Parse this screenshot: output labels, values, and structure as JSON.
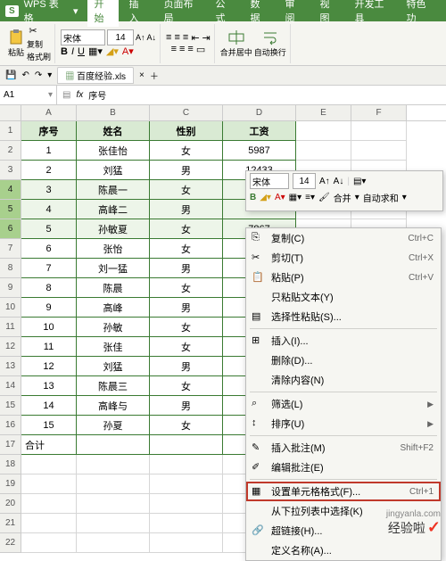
{
  "app": {
    "logo": "S",
    "name": "WPS 表格"
  },
  "tabs": [
    "开始",
    "插入",
    "页面布局",
    "公式",
    "数据",
    "审阅",
    "视图",
    "开发工具",
    "特色功"
  ],
  "active_tab": 0,
  "ribbon": {
    "paste": "粘贴",
    "copy": "复制",
    "cut_icon": "cut",
    "format_painter": "格式刷",
    "font_name": "宋体",
    "font_size": "14",
    "merge_center": "合并居中",
    "autowrap": "自动换行"
  },
  "filebar": {
    "filename": "百度经验.xls"
  },
  "formula": {
    "cellref": "A1",
    "fx": "fx",
    "content": "序号"
  },
  "col_headers": [
    "A",
    "B",
    "C",
    "D",
    "E",
    "F"
  ],
  "table": {
    "headers": [
      "序号",
      "姓名",
      "性别",
      "工资"
    ],
    "rows": [
      [
        "1",
        "张佳怡",
        "女",
        "5987"
      ],
      [
        "2",
        "刘猛",
        "男",
        "12433"
      ],
      [
        "3",
        "陈晨一",
        "女",
        ""
      ],
      [
        "4",
        "高峰二",
        "男",
        ""
      ],
      [
        "5",
        "孙敏夏",
        "女",
        "7867"
      ],
      [
        "6",
        "张怡",
        "女",
        ""
      ],
      [
        "7",
        "刘一猛",
        "男",
        ""
      ],
      [
        "8",
        "陈晨",
        "女",
        ""
      ],
      [
        "9",
        "高峰",
        "男",
        ""
      ],
      [
        "10",
        "孙敏",
        "女",
        ""
      ],
      [
        "11",
        "张佳",
        "女",
        ""
      ],
      [
        "12",
        "刘猛",
        "男",
        ""
      ],
      [
        "13",
        "陈晨三",
        "女",
        ""
      ],
      [
        "14",
        "高峰与",
        "男",
        ""
      ],
      [
        "15",
        "孙夏",
        "女",
        ""
      ]
    ],
    "total_label": "合计"
  },
  "mini": {
    "font": "宋体",
    "size": "14",
    "merge": "合并",
    "autosum": "自动求和"
  },
  "ctx": [
    {
      "icon": "copy",
      "label": "复制(C)",
      "shortcut": "Ctrl+C"
    },
    {
      "icon": "cut",
      "label": "剪切(T)",
      "shortcut": "Ctrl+X"
    },
    {
      "icon": "paste",
      "label": "粘贴(P)",
      "shortcut": "Ctrl+V"
    },
    {
      "icon": "",
      "label": "只粘贴文本(Y)",
      "shortcut": ""
    },
    {
      "icon": "paste-sp",
      "label": "选择性粘贴(S)...",
      "shortcut": ""
    },
    {
      "sep": true
    },
    {
      "icon": "insert",
      "label": "插入(I)...",
      "shortcut": ""
    },
    {
      "icon": "",
      "label": "删除(D)...",
      "shortcut": ""
    },
    {
      "icon": "",
      "label": "清除内容(N)",
      "shortcut": ""
    },
    {
      "sep": true
    },
    {
      "icon": "filter",
      "label": "筛选(L)",
      "arrow": true
    },
    {
      "icon": "sort",
      "label": "排序(U)",
      "arrow": true
    },
    {
      "sep": true
    },
    {
      "icon": "comment",
      "label": "插入批注(M)",
      "shortcut": "Shift+F2"
    },
    {
      "icon": "edit",
      "label": "编辑批注(E)",
      "shortcut": ""
    },
    {
      "sep": true
    },
    {
      "icon": "format",
      "label": "设置单元格格式(F)...",
      "shortcut": "Ctrl+1",
      "hl": true
    },
    {
      "icon": "",
      "label": "从下拉列表中选择(K)",
      "shortcut": ""
    },
    {
      "icon": "link",
      "label": "超链接(H)...",
      "shortcut": ""
    },
    {
      "icon": "",
      "label": "定义名称(A)...",
      "shortcut": ""
    }
  ],
  "watermark": {
    "text": "经验啦",
    "url": "jingyanla.com"
  }
}
